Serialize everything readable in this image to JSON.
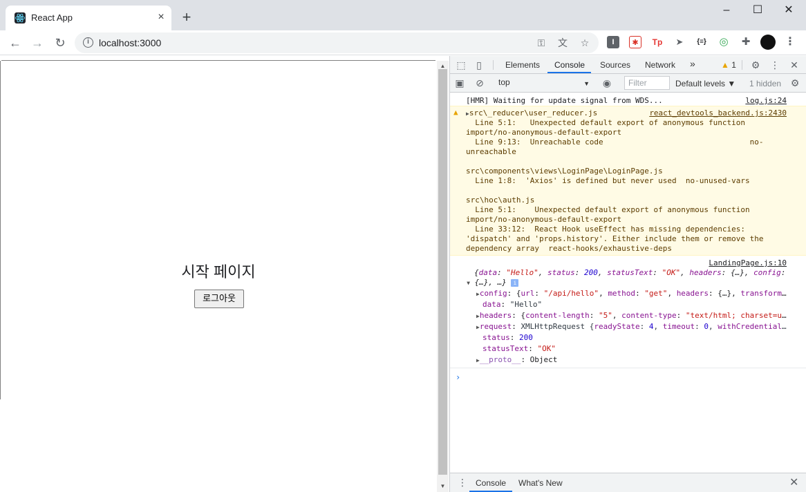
{
  "browser": {
    "tab_title": "React App",
    "tab_close": "×",
    "new_tab": "+",
    "win_min": "–",
    "win_max": "☐",
    "win_close": "✕",
    "url": "localhost:3000",
    "back": "←",
    "forward": "→",
    "reload": "↻",
    "info_glyph": "i",
    "extensions": [
      {
        "name": "ext-i",
        "glyph": "I",
        "color": "#5f6368"
      },
      {
        "name": "ext-bug",
        "glyph": "✱",
        "color": "#d93025"
      },
      {
        "name": "ext-tp",
        "glyph": "Tp",
        "color": "#ffffff"
      },
      {
        "name": "ext-cursor",
        "glyph": "➤",
        "color": "#ffffff"
      },
      {
        "name": "ext-json",
        "glyph": "{≡}",
        "color": "#ffffff"
      },
      {
        "name": "ext-circle",
        "glyph": "◎",
        "color": "#ffffff"
      }
    ]
  },
  "page": {
    "heading": "시작 페이지",
    "logout_button": "로그아웃"
  },
  "devtools": {
    "tabs": [
      "Elements",
      "Console",
      "Sources",
      "Network"
    ],
    "more_tabs": "»",
    "warning_count": "1",
    "context": "top",
    "filter_placeholder": "Filter",
    "levels": "Default levels ▼",
    "hidden": "1 hidden",
    "messages": {
      "hmr": "[HMR] Waiting for update signal from WDS...",
      "hmr_src": "log.js:24",
      "warn_src": "react_devtools_backend.js:2430",
      "warn_lines": [
        "src\\_reducer\\user_reducer.js",
        "  Line 5:1:   Unexpected default export of anonymous function",
        "import/no-anonymous-default-export",
        "  Line 9:13:  Unreachable code                                no-",
        "unreachable",
        "",
        "src\\components\\views\\LoginPage\\LoginPage.js",
        "  Line 1:8:  'Axios' is defined but never used  no-unused-vars",
        "",
        "src\\hoc\\auth.js",
        "  Line 5:1:    Unexpected default export of anonymous function",
        "import/no-anonymous-default-export",
        "  Line 33:12:  React Hook useEffect has missing dependencies:",
        "'dispatch' and 'props.history'. Either include them or remove the",
        "dependency array  react-hooks/exhaustive-deps"
      ],
      "landing_src": "LandingPage.js:10"
    },
    "drawer_tabs": [
      "Console",
      "What's New"
    ]
  }
}
